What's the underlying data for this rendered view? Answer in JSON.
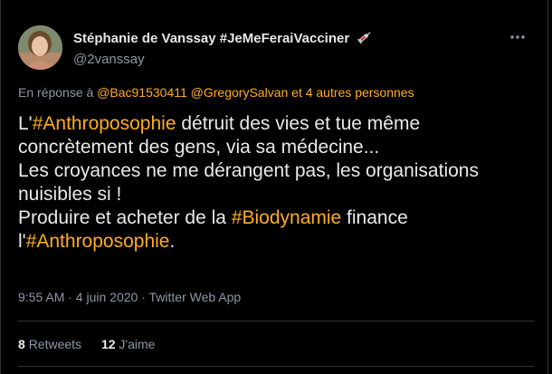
{
  "tweet": {
    "author": {
      "display_name": "Stéphanie de Vanssay #JeMeFeraiVacciner",
      "handle": "@2vanssay"
    },
    "reply_to": {
      "prefix": "En réponse à",
      "mention1": "@Bac91530411",
      "mention2": "@GregorySalvan",
      "suffix": "et 4 autres personnes"
    },
    "text": {
      "l1_pre": "L'",
      "l1_tag": "#Anthroposophie",
      "l1_post": " détruit des vies et tue même",
      "l2": "concrètement des gens, via sa médecine...",
      "l3": "Les croyances ne me dérangent pas, les organisations",
      "l4": "nuisibles si !",
      "l5_pre": "Produire et acheter de la ",
      "l5_tag": "#Biodynamie",
      "l5_post": " finance",
      "l6_pre": "l'",
      "l6_tag": "#Anthroposophie",
      "l6_post": "."
    },
    "meta": "9:55 AM · 4 juin 2020 · Twitter Web App",
    "stats": {
      "retweets_count": "8",
      "retweets_label": "Retweets",
      "likes_count": "12",
      "likes_label": "J'aime"
    }
  },
  "colors": {
    "background": "#000000",
    "hashtag": "#ffad1f",
    "secondary_text": "#8b98a5",
    "primary_text": "#e7e9ea",
    "divider": "#2f3336"
  },
  "icons": {
    "syringe": "syringe-icon",
    "more": "more-icon"
  }
}
